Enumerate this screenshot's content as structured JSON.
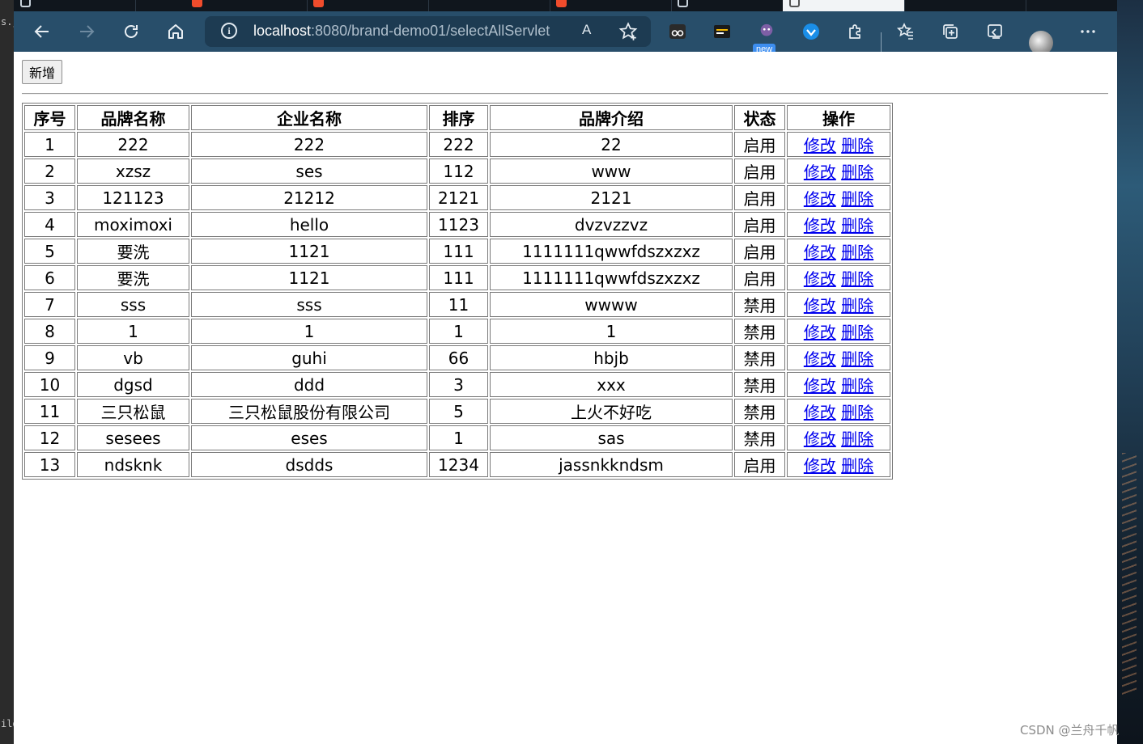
{
  "desktop": {
    "left_text_1": "s.j",
    "left_text_2": "ild"
  },
  "browser": {
    "address": {
      "host": "localhost",
      "path": ":8080/brand-demo01/selectAllServlet"
    },
    "read_aloud_glyph": "A",
    "extensions": {
      "new_badge": "new"
    }
  },
  "page": {
    "add_button": "新增",
    "table": {
      "headers": [
        "序号",
        "品牌名称",
        "企业名称",
        "排序",
        "品牌介绍",
        "状态",
        "操作"
      ],
      "edit_label": "修改",
      "delete_label": "删除",
      "rows": [
        {
          "id": "1",
          "brand": "222",
          "company": "222",
          "ordered": "222",
          "description": "22",
          "status": "启用"
        },
        {
          "id": "2",
          "brand": "xzsz",
          "company": "ses",
          "ordered": "112",
          "description": "www",
          "status": "启用"
        },
        {
          "id": "3",
          "brand": "121123",
          "company": "21212",
          "ordered": "2121",
          "description": "2121",
          "status": "启用"
        },
        {
          "id": "4",
          "brand": "moximoxi",
          "company": "hello",
          "ordered": "1123",
          "description": "dvzvzzvz",
          "status": "启用"
        },
        {
          "id": "5",
          "brand": "要洗",
          "company": "1121",
          "ordered": "111",
          "description": "1111111qwwfdszxzxz",
          "status": "启用"
        },
        {
          "id": "6",
          "brand": "要洗",
          "company": "1121",
          "ordered": "111",
          "description": "1111111qwwfdszxzxz",
          "status": "启用"
        },
        {
          "id": "7",
          "brand": "sss",
          "company": "sss",
          "ordered": "11",
          "description": "wwww",
          "status": "禁用"
        },
        {
          "id": "8",
          "brand": "1",
          "company": "1",
          "ordered": "1",
          "description": "1",
          "status": "禁用"
        },
        {
          "id": "9",
          "brand": "vb",
          "company": "guhi",
          "ordered": "66",
          "description": "hbjb",
          "status": "禁用"
        },
        {
          "id": "10",
          "brand": "dgsd",
          "company": "ddd",
          "ordered": "3",
          "description": "xxx",
          "status": "禁用"
        },
        {
          "id": "11",
          "brand": "三只松鼠",
          "company": "三只松鼠股份有限公司",
          "ordered": "5",
          "description": "上火不好吃",
          "status": "禁用"
        },
        {
          "id": "12",
          "brand": "sesees",
          "company": "eses",
          "ordered": "1",
          "description": "sas",
          "status": "禁用"
        },
        {
          "id": "13",
          "brand": "ndsknk",
          "company": "dsdds",
          "ordered": "1234",
          "description": "jassnkkndsm",
          "status": "启用"
        }
      ]
    }
  },
  "watermark": "CSDN @兰舟千帆",
  "colors": {
    "toolbar": "#284e6a",
    "address_bar": "#1d3b52",
    "link": "#0000ee",
    "tab_favicon": "#f04c2c"
  }
}
